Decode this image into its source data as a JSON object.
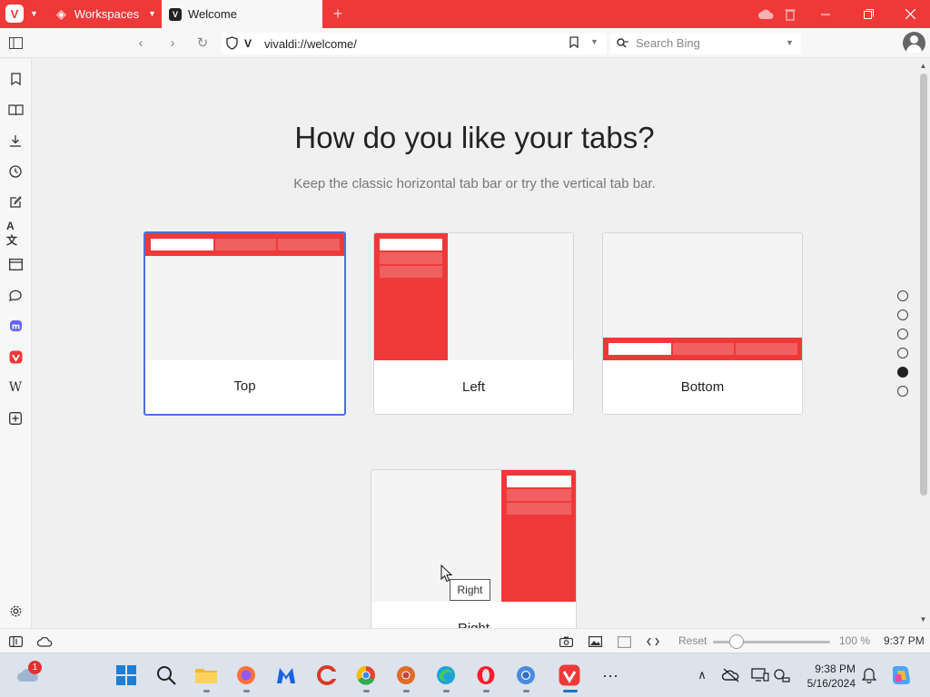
{
  "browser": {
    "workspaces_label": "Workspaces",
    "tab_title": "Welcome",
    "tab_favicon": "V",
    "new_tab_glyph": "+",
    "url": "vivaldi://welcome/",
    "search_placeholder": "Search Bing",
    "accent_color": "#ef3939"
  },
  "page": {
    "title": "How do you like your tabs?",
    "subtitle": "Keep the classic horizontal tab bar or try the vertical tab bar.",
    "options": [
      {
        "label": "Top",
        "selected": true
      },
      {
        "label": "Left",
        "selected": false
      },
      {
        "label": "Bottom",
        "selected": false
      },
      {
        "label": "Right",
        "selected": false
      }
    ],
    "tooltip": "Right",
    "pager": {
      "count": 6,
      "active_index": 4
    }
  },
  "statusbar": {
    "reset_label": "Reset",
    "zoom_value": "100 %",
    "clock": "9:37 PM"
  },
  "taskbar": {
    "time": "9:38 PM",
    "date": "5/16/2024",
    "notification_count": "1"
  },
  "side_panel_icons": [
    "bookmarks-icon",
    "reading-list-icon",
    "downloads-icon",
    "history-icon",
    "notes-icon",
    "translate-icon",
    "window-panel-icon",
    "chat-icon",
    "mastodon-icon",
    "vivaldi-icon",
    "wikipedia-icon",
    "add-panel-icon"
  ]
}
